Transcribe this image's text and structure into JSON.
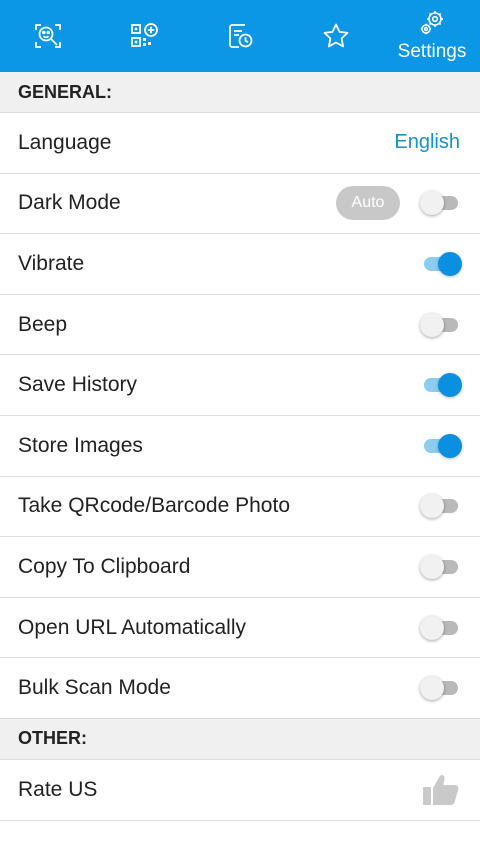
{
  "tabs": [
    {
      "icon": "scan-face-icon",
      "label": ""
    },
    {
      "icon": "qr-add-icon",
      "label": ""
    },
    {
      "icon": "history-icon",
      "label": ""
    },
    {
      "icon": "star-icon",
      "label": ""
    },
    {
      "icon": "gear-icon",
      "label": "Settings"
    }
  ],
  "sections": {
    "general": "GENERAL:",
    "other": "OTHER:"
  },
  "settings": {
    "language": {
      "label": "Language",
      "value": "English"
    },
    "dark_mode": {
      "label": "Dark Mode",
      "badge": "Auto",
      "enabled": false
    },
    "vibrate": {
      "label": "Vibrate",
      "enabled": true
    },
    "beep": {
      "label": "Beep",
      "enabled": false
    },
    "save_history": {
      "label": "Save History",
      "enabled": true
    },
    "store_images": {
      "label": "Store Images",
      "enabled": true
    },
    "take_photo": {
      "label": "Take QRcode/Barcode Photo",
      "enabled": false
    },
    "copy_clipboard": {
      "label": "Copy To Clipboard",
      "enabled": false
    },
    "open_url": {
      "label": "Open URL Automatically",
      "enabled": false
    },
    "bulk_scan": {
      "label": "Bulk Scan Mode",
      "enabled": false
    }
  },
  "other": {
    "rate_us": {
      "label": "Rate US",
      "icon": "thumbs-up-icon"
    }
  },
  "colors": {
    "accent": "#0b97e6",
    "toggle_on": "#0b8fe0",
    "link": "#1691cf"
  }
}
